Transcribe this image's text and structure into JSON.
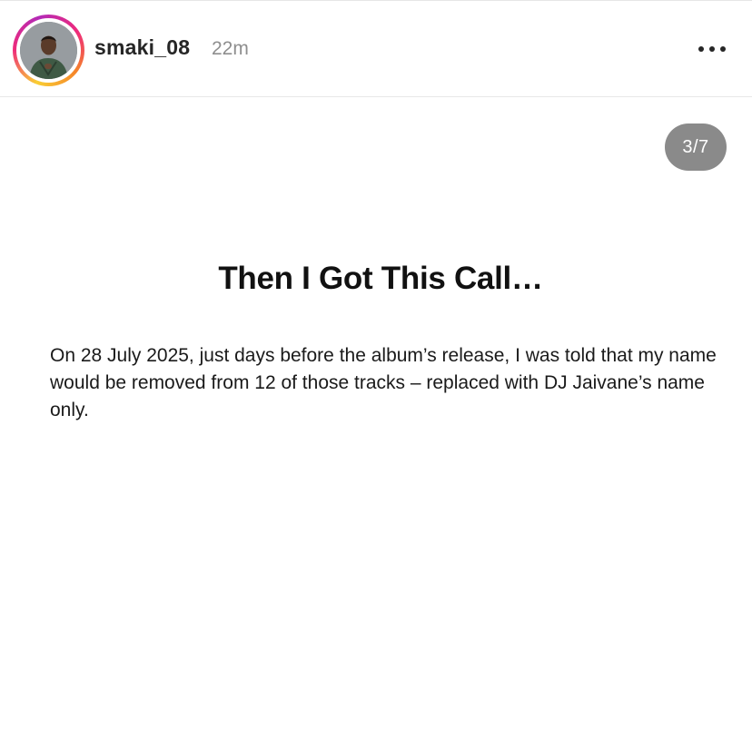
{
  "post": {
    "username": "smaki_08",
    "time_ago": "22m",
    "more_icon": "more-horizontal-icon"
  },
  "slide": {
    "indicator": "3/7",
    "title": "Then I Got This Call…",
    "body": "On 28 July 2025, just days before the album’s release, I was told that my name would be removed from 12 of those tracks – replaced with DJ Jaivane’s name only."
  },
  "colors": {
    "username": "#262626",
    "timestamp": "#8e8e8e",
    "indicator_bg": "#8a8a8a",
    "story_ring": [
      "#f9ce34",
      "#ee2a7b",
      "#b32ab7"
    ]
  }
}
